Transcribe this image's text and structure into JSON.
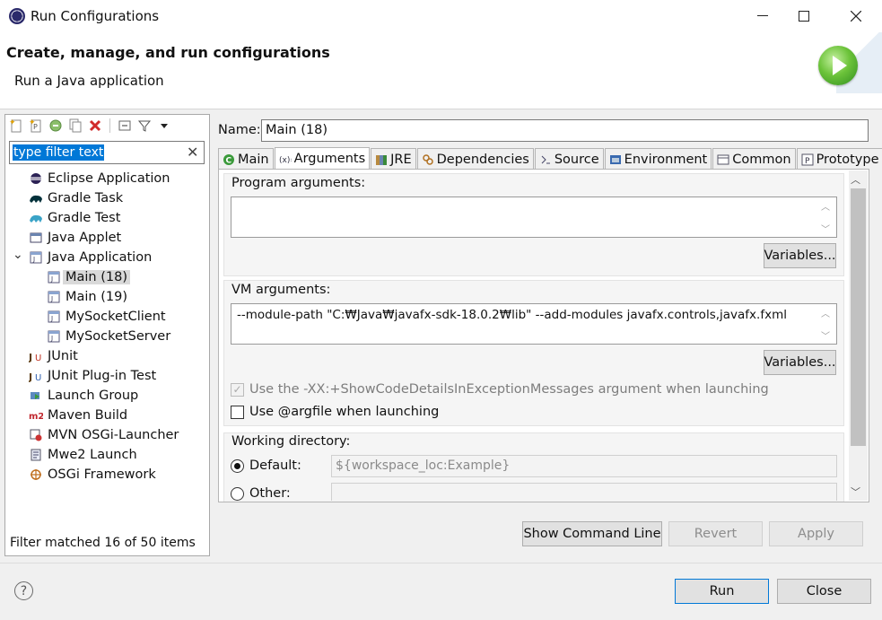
{
  "window": {
    "title": "Run Configurations"
  },
  "header": {
    "title": "Create, manage, and run configurations",
    "subtitle": "Run a Java application"
  },
  "left": {
    "filter_placeholder": "type filter text",
    "tree": [
      {
        "label": "Eclipse Application",
        "icon": "eclipse-icon",
        "level": 0
      },
      {
        "label": "Gradle Task",
        "icon": "gradle-icon",
        "level": 0
      },
      {
        "label": "Gradle Test",
        "icon": "gradle-test-icon",
        "level": 0
      },
      {
        "label": "Java Applet",
        "icon": "java-applet-icon",
        "level": 0
      },
      {
        "label": "Java Application",
        "icon": "java-app-icon",
        "level": 0,
        "expanded": true
      },
      {
        "label": "Main (18)",
        "icon": "java-config-icon",
        "level": 1,
        "selected": true
      },
      {
        "label": "Main (19)",
        "icon": "java-config-icon",
        "level": 1
      },
      {
        "label": "MySocketClient",
        "icon": "java-config-icon",
        "level": 1
      },
      {
        "label": "MySocketServer",
        "icon": "java-config-icon",
        "level": 1
      },
      {
        "label": "JUnit",
        "icon": "junit-icon",
        "level": 0
      },
      {
        "label": "JUnit Plug-in Test",
        "icon": "junit-plugin-icon",
        "level": 0
      },
      {
        "label": "Launch Group",
        "icon": "launch-group-icon",
        "level": 0
      },
      {
        "label": "Maven Build",
        "icon": "maven-icon",
        "level": 0
      },
      {
        "label": "MVN OSGi-Launcher",
        "icon": "osgi-launcher-icon",
        "level": 0
      },
      {
        "label": "Mwe2 Launch",
        "icon": "mwe2-icon",
        "level": 0
      },
      {
        "label": "OSGi Framework",
        "icon": "osgi-icon",
        "level": 0
      }
    ],
    "status": "Filter matched 16 of 50 items"
  },
  "right": {
    "name_label": "Name:",
    "name_value": "Main (18)",
    "tabs": [
      {
        "label": "Main",
        "icon": "main-tab-icon"
      },
      {
        "label": "Arguments",
        "icon": "arguments-tab-icon",
        "active": true
      },
      {
        "label": "JRE",
        "icon": "jre-tab-icon"
      },
      {
        "label": "Dependencies",
        "icon": "dependencies-tab-icon"
      },
      {
        "label": "Source",
        "icon": "source-tab-icon"
      },
      {
        "label": "Environment",
        "icon": "environment-tab-icon"
      },
      {
        "label": "Common",
        "icon": "common-tab-icon"
      },
      {
        "label": "Prototype",
        "icon": "prototype-tab-icon"
      }
    ],
    "program_args": {
      "title": "Program arguments:",
      "value": "",
      "variables": "Variables..."
    },
    "vm_args": {
      "title": "VM arguments:",
      "value": "--module-path \"C:₩Java₩javafx-sdk-18.0.2₩lib\" --add-modules javafx.controls,javafx.fxml",
      "variables": "Variables..."
    },
    "show_code_details": "Use the -XX:+ShowCodeDetailsInExceptionMessages argument when launching",
    "use_argfile": "Use @argfile when launching",
    "working_dir": {
      "title": "Working directory:",
      "default_label": "Default:",
      "default_value": "${workspace_loc:Example}",
      "other_label": "Other:"
    },
    "buttons": {
      "show_command_line": "Show Command Line",
      "revert": "Revert",
      "apply": "Apply"
    }
  },
  "footer": {
    "run": "Run",
    "close": "Close",
    "help": "?"
  }
}
